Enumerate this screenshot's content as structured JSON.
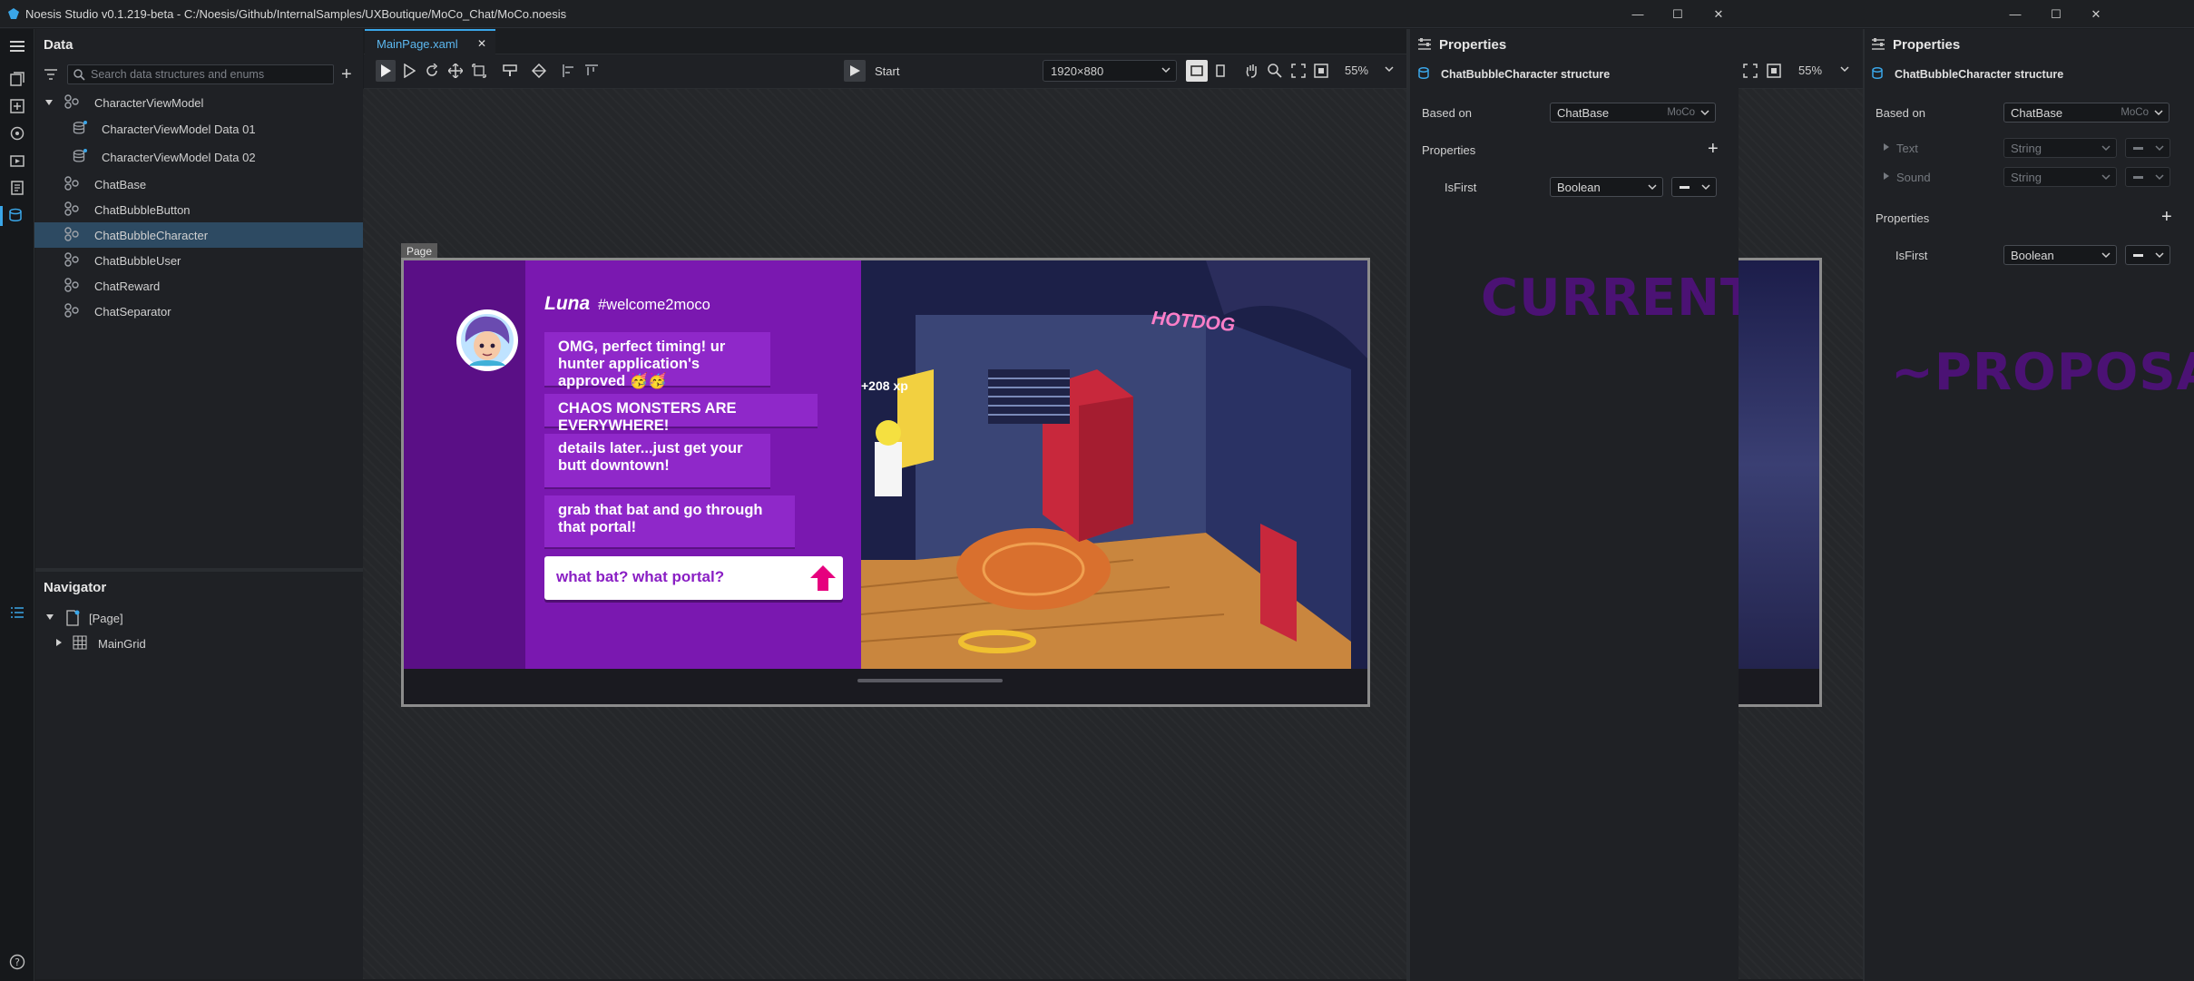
{
  "window": {
    "title": "Noesis Studio v0.1.219-beta - C:/Noesis/Github/InternalSamples/UXBoutique/MoCo_Chat/MoCo.noesis",
    "minimize_label": "—",
    "maximize_label": "☐",
    "close_label": "✕"
  },
  "data_panel": {
    "title": "Data",
    "search_placeholder": "Search data structures and enums",
    "items": [
      {
        "label": "CharacterViewModel"
      },
      {
        "label": "CharacterViewModel Data 01"
      },
      {
        "label": "CharacterViewModel Data 02"
      },
      {
        "label": "ChatBase"
      },
      {
        "label": "ChatBubbleButton"
      },
      {
        "label": "ChatBubbleCharacter"
      },
      {
        "label": "ChatBubbleUser"
      },
      {
        "label": "ChatReward"
      },
      {
        "label": "ChatSeparator"
      }
    ],
    "selected": "ChatBubbleCharacter"
  },
  "navigator": {
    "title": "Navigator",
    "items": [
      {
        "label": "[Page]"
      },
      {
        "label": "MainGrid"
      }
    ]
  },
  "editor": {
    "tab_label": "MainPage.xaml",
    "tab_close": "✕",
    "start_label": "Start",
    "resolution": "1920×880",
    "zoom": "55%",
    "page_label": "Page"
  },
  "game": {
    "character_name": "Luna",
    "channel": "#welcome2moco",
    "messages": [
      "OMG, perfect timing! ur hunter application's approved 🥳🥳",
      "CHAOS MONSTERS ARE EVERYWHERE!",
      "details later...just get your butt downtown!",
      "grab that bat and go through that portal!"
    ],
    "reply": "what bat? what portal?",
    "xp_badge": "+208 xp",
    "sign": "HOTDOG"
  },
  "properties_current": {
    "title": "Properties",
    "structure": "ChatBubbleCharacter structure",
    "based_on_label": "Based on",
    "based_on_value": "ChatBase",
    "based_on_source": "MoCo",
    "properties_label": "Properties",
    "prop_name": "IsFirst",
    "prop_type": "Boolean",
    "watermark": "CURRENT"
  },
  "properties_proposal": {
    "title": "Properties",
    "structure": "ChatBubbleCharacter structure",
    "based_on_label": "Based on",
    "based_on_value": "ChatBase",
    "based_on_source": "MoCo",
    "inherited": [
      {
        "name": "Text",
        "type": "String"
      },
      {
        "name": "Sound",
        "type": "String"
      }
    ],
    "properties_label": "Properties",
    "prop_name": "IsFirst",
    "prop_type": "Boolean",
    "zoom": "55%",
    "watermark": "~PROPOSAL"
  },
  "colors": {
    "accent_blue": "#2d4a62",
    "chat_purple": "#7a18b0",
    "bubble_purple": "#8f28c9",
    "reply_pink": "#e6007e",
    "watermark_purple": "#4b1274"
  }
}
